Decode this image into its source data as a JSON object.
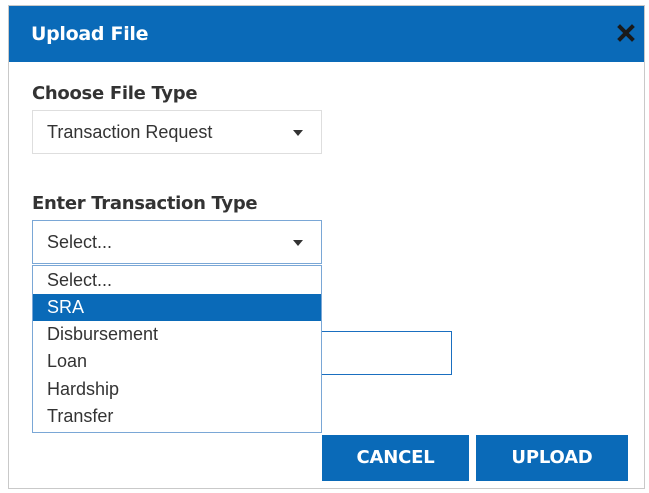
{
  "dialog": {
    "title": "Upload File"
  },
  "file_type": {
    "label": "Choose File Type",
    "selected": "Transaction Request"
  },
  "transaction_type": {
    "label": "Enter Transaction Type",
    "selected": "Select...",
    "options": [
      "Select...",
      "SRA",
      "Disbursement",
      "Loan",
      "Hardship",
      "Transfer"
    ],
    "highlighted_option": "SRA"
  },
  "buttons": {
    "cancel": "CANCEL",
    "upload": "UPLOAD"
  },
  "colors": {
    "accent": "#0a6ab8",
    "text": "#333333"
  },
  "icons": {
    "close": "close-icon",
    "caret": "chevron-down-icon"
  }
}
